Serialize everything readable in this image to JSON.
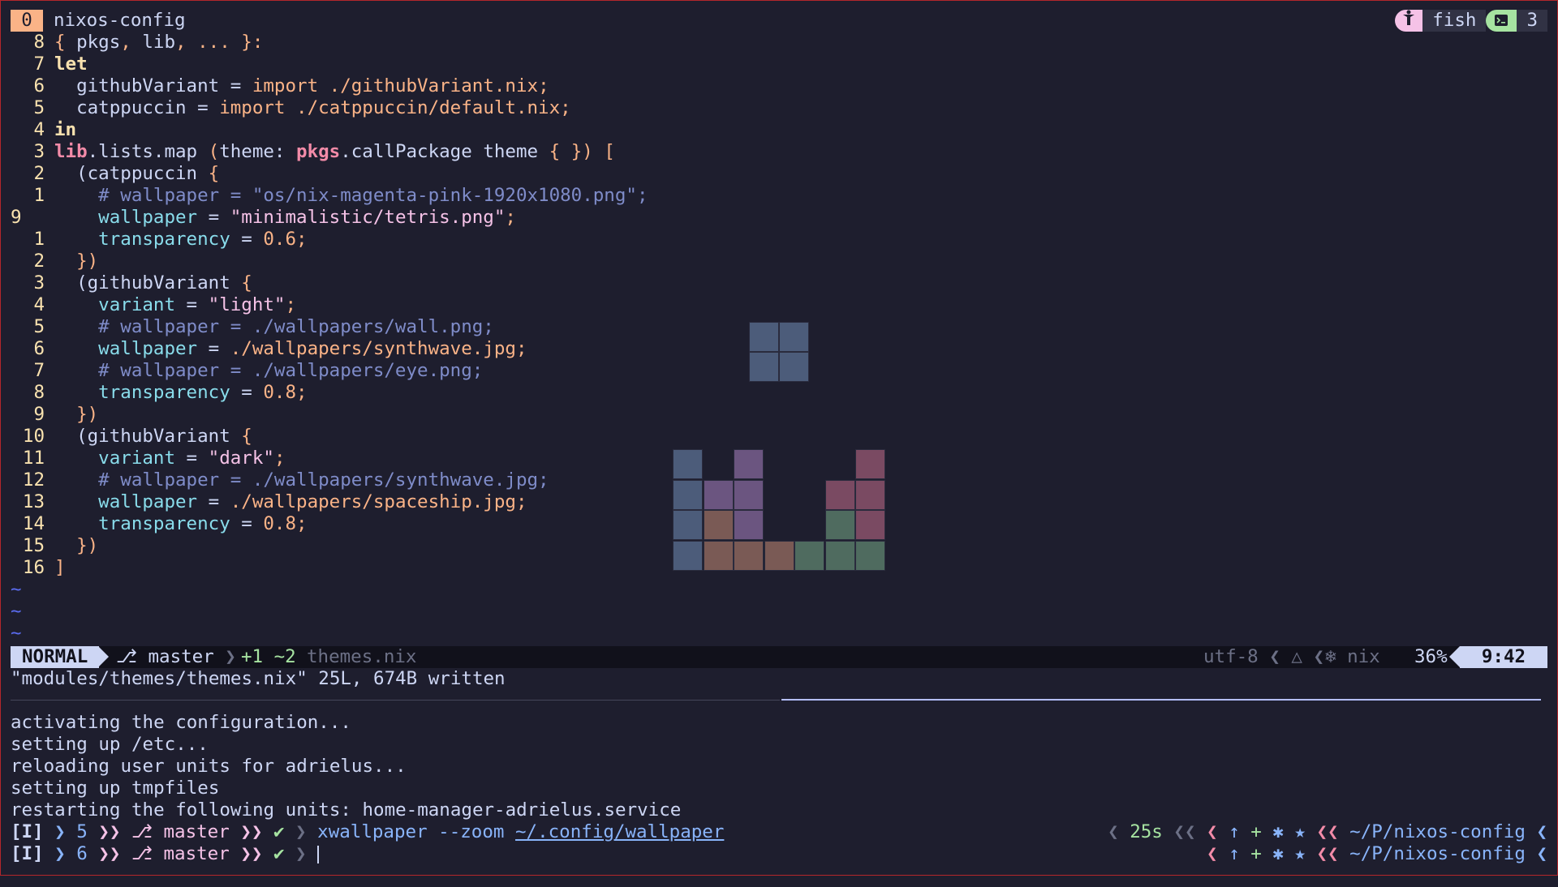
{
  "tabbar": {
    "tab_number": "0",
    "title": "nixos-config",
    "shell_name": "fish",
    "window_count": "3",
    "icons": [
      "person-icon",
      "terminal-icon"
    ]
  },
  "editor": {
    "lines": [
      {
        "gutter": "8",
        "segments": [
          {
            "t": "{ ",
            "c": "brc"
          },
          {
            "t": "pkgs"
          },
          {
            "t": ", ",
            "c": "brc"
          },
          {
            "t": "lib"
          },
          {
            "t": ", ... }:",
            "c": "brc"
          }
        ]
      },
      {
        "gutter": "7",
        "segments": [
          {
            "t": "let",
            "c": "kw"
          }
        ]
      },
      {
        "gutter": "6",
        "segments": [
          {
            "t": "  githubVariant = "
          },
          {
            "t": "import",
            "c": "imp"
          },
          {
            "t": " ./githubVariant.nix",
            "c": "path"
          },
          {
            "t": ";",
            "c": "brc"
          }
        ]
      },
      {
        "gutter": "5",
        "segments": [
          {
            "t": "  catppuccin = "
          },
          {
            "t": "import",
            "c": "imp"
          },
          {
            "t": " ./catppuccin/default.nix",
            "c": "path"
          },
          {
            "t": ";",
            "c": "brc"
          }
        ]
      },
      {
        "gutter": "4",
        "segments": [
          {
            "t": "in",
            "c": "kw"
          }
        ]
      },
      {
        "gutter": "3",
        "segments": [
          {
            "t": "lib",
            "c": "pk"
          },
          {
            "t": ".lists.map "
          },
          {
            "t": "(",
            "c": "brc"
          },
          {
            "t": "theme: "
          },
          {
            "t": "pkgs",
            "c": "pk"
          },
          {
            "t": ".callPackage theme "
          },
          {
            "t": "{ })",
            "c": "brc"
          },
          {
            "t": " [",
            "c": "brc"
          }
        ]
      },
      {
        "gutter": "2",
        "segments": [
          {
            "t": "  ("
          },
          {
            "t": "catppuccin "
          },
          {
            "t": "{",
            "c": "brc"
          }
        ]
      },
      {
        "gutter": "1",
        "segments": [
          {
            "t": "    # wallpaper = \"os/nix-magenta-pink-1920x1080.png\";",
            "c": "cmt"
          }
        ]
      },
      {
        "gutter": "9",
        "current": true,
        "segments": [
          {
            "t": "    wallpaper",
            "c": "attr"
          },
          {
            "t": " = "
          },
          {
            "t": "\"minimalistic/tetris.png\"",
            "c": "str"
          },
          {
            "t": ";",
            "c": "brc"
          }
        ]
      },
      {
        "gutter": "1",
        "segments": [
          {
            "t": "    transparency",
            "c": "attr"
          },
          {
            "t": " = "
          },
          {
            "t": "0.6",
            "c": "num"
          },
          {
            "t": ";",
            "c": "brc"
          }
        ]
      },
      {
        "gutter": "2",
        "segments": [
          {
            "t": "  })",
            "c": "brc"
          }
        ]
      },
      {
        "gutter": "3",
        "segments": [
          {
            "t": "  (githubVariant "
          },
          {
            "t": "{",
            "c": "brc"
          }
        ]
      },
      {
        "gutter": "4",
        "segments": [
          {
            "t": "    variant",
            "c": "attr"
          },
          {
            "t": " = "
          },
          {
            "t": "\"light\"",
            "c": "str"
          },
          {
            "t": ";",
            "c": "brc"
          }
        ]
      },
      {
        "gutter": "5",
        "segments": [
          {
            "t": "    # wallpaper = ./wallpapers/wall.png;",
            "c": "cmt"
          }
        ]
      },
      {
        "gutter": "6",
        "segments": [
          {
            "t": "    wallpaper",
            "c": "attr"
          },
          {
            "t": " = "
          },
          {
            "t": "./wallpapers/synthwave.jpg",
            "c": "path"
          },
          {
            "t": ";",
            "c": "brc"
          }
        ]
      },
      {
        "gutter": "7",
        "segments": [
          {
            "t": "    # wallpaper = ./wallpapers/eye.png;",
            "c": "cmt"
          }
        ]
      },
      {
        "gutter": "8",
        "segments": [
          {
            "t": "    transparency",
            "c": "attr"
          },
          {
            "t": " = "
          },
          {
            "t": "0.8",
            "c": "num"
          },
          {
            "t": ";",
            "c": "brc"
          }
        ]
      },
      {
        "gutter": "9",
        "segments": [
          {
            "t": "  })",
            "c": "brc"
          }
        ]
      },
      {
        "gutter": "10",
        "segments": [
          {
            "t": "  (githubVariant "
          },
          {
            "t": "{",
            "c": "brc"
          }
        ]
      },
      {
        "gutter": "11",
        "segments": [
          {
            "t": "    variant",
            "c": "attr"
          },
          {
            "t": " = "
          },
          {
            "t": "\"dark\"",
            "c": "str"
          },
          {
            "t": ";",
            "c": "brc"
          }
        ]
      },
      {
        "gutter": "12",
        "segments": [
          {
            "t": "    # wallpaper = ./wallpapers/synthwave.jpg;",
            "c": "cmt"
          }
        ]
      },
      {
        "gutter": "13",
        "segments": [
          {
            "t": "    wallpaper",
            "c": "attr"
          },
          {
            "t": " = "
          },
          {
            "t": "./wallpapers/spaceship.jpg",
            "c": "path"
          },
          {
            "t": ";",
            "c": "brc"
          }
        ]
      },
      {
        "gutter": "14",
        "segments": [
          {
            "t": "    transparency",
            "c": "attr"
          },
          {
            "t": " = "
          },
          {
            "t": "0.8",
            "c": "num"
          },
          {
            "t": ";",
            "c": "brc"
          }
        ]
      },
      {
        "gutter": "15",
        "segments": [
          {
            "t": "  })",
            "c": "brc"
          }
        ]
      },
      {
        "gutter": "16",
        "segments": [
          {
            "t": "]",
            "c": "brc"
          }
        ]
      }
    ],
    "empty_line_marker": "~",
    "empty_line_count": 3
  },
  "statusline": {
    "mode": "NORMAL",
    "branch": "master",
    "diff": "+1 ~2",
    "filename": "themes.nix",
    "encoding": "utf-8",
    "filetype": "nix",
    "percent": "36%",
    "position": "9:42",
    "icons": [
      "git-branch-icon",
      "linux-icon",
      "nix-snowflake-icon"
    ]
  },
  "message": "\"modules/themes/themes.nix\" 25L, 674B written",
  "terminal": {
    "output": [
      "activating the configuration...",
      "setting up /etc...",
      "reloading user units for adrielus...",
      "setting up tmpfiles",
      "restarting the following units: home-manager-adrielus.service"
    ],
    "prompts": [
      {
        "mode": "[I]",
        "num": "5",
        "branch": "master",
        "command": "xwallpaper",
        "flag": "--zoom",
        "arg": "~/.config/wallpaper",
        "duration": "25s",
        "dir": "~/P/nixos-config"
      },
      {
        "mode": "[I]",
        "num": "6",
        "branch": "master",
        "command": "",
        "flag": "",
        "arg": "",
        "duration": "",
        "dir": "~/P/nixos-config"
      }
    ]
  },
  "tetris": {
    "palette": {
      "blue": "#4c5c7a",
      "purple": "#6b5580",
      "brown": "#7a5a55",
      "green": "#4f6b5f",
      "rose": "#7a4a62"
    }
  }
}
